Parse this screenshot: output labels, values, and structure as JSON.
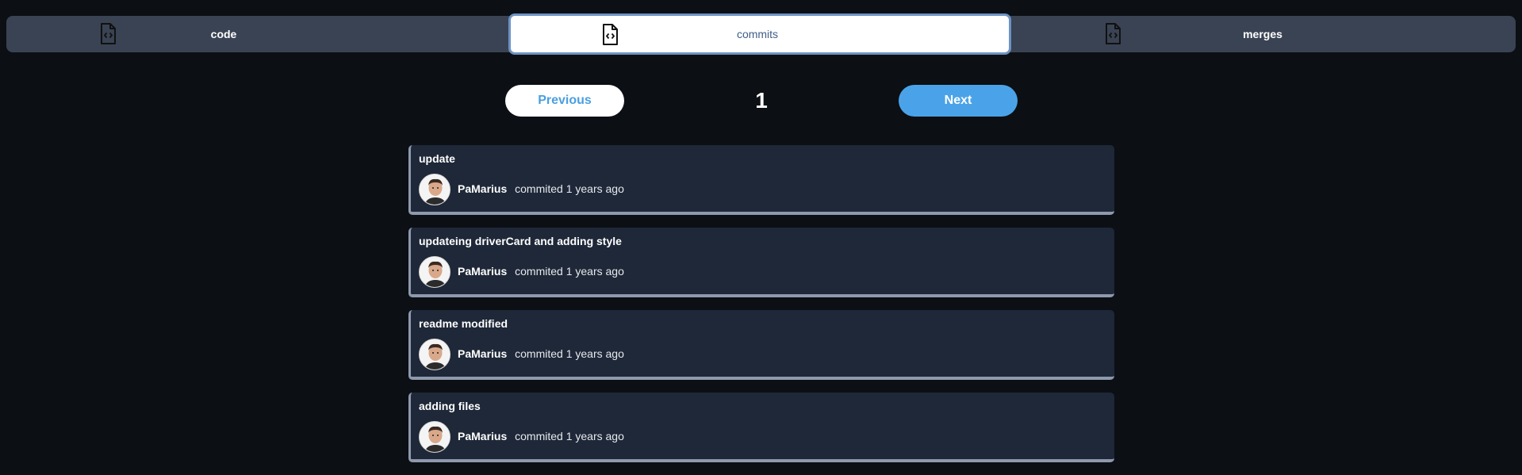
{
  "tabs": [
    {
      "label": "code",
      "icon": "code-file-icon",
      "active": false
    },
    {
      "label": "commits",
      "icon": "code-file-icon",
      "active": true
    },
    {
      "label": "merges",
      "icon": "code-file-icon",
      "active": false
    }
  ],
  "pagination": {
    "previous_label": "Previous",
    "page": "1",
    "next_label": "Next"
  },
  "commits": [
    {
      "title": "update",
      "author": "PaMarius",
      "meta": "commited 1 years ago"
    },
    {
      "title": "updateing driverCard and adding style",
      "author": "PaMarius",
      "meta": "commited 1 years ago"
    },
    {
      "title": "readme modified",
      "author": "PaMarius",
      "meta": "commited 1 years ago"
    },
    {
      "title": "adding files",
      "author": "PaMarius",
      "meta": "commited 1 years ago"
    }
  ],
  "colors": {
    "background": "#0c0f14",
    "tabbar": "#3a4353",
    "card": "#1e2838",
    "accent": "#4aa3e8"
  }
}
